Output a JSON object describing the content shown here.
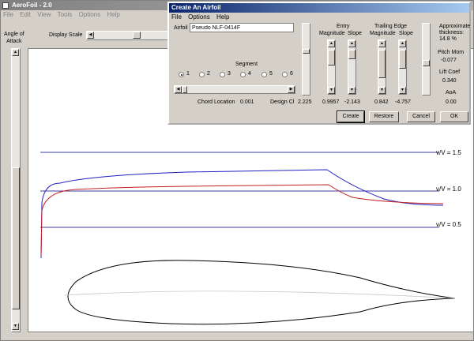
{
  "main": {
    "title": "AeroFoil - 2.0",
    "menu": [
      "File",
      "Edit",
      "View",
      "Tools",
      "Options",
      "Help"
    ],
    "angle_label_1": "Angle of",
    "angle_label_2": "Attack",
    "display_scale_label": "Display Scale"
  },
  "plot": {
    "velocity_labels": [
      "v/V = 1.5",
      "v/V = 1.0",
      "v/V = 0.5"
    ],
    "colors": {
      "upper": "#2020c0",
      "lower": "#c02020",
      "reference": "#000080",
      "profile": "#000000"
    }
  },
  "dialog": {
    "title": "Create An Airfoil",
    "menu": [
      "File",
      "Options",
      "Help"
    ],
    "airfoil_label": "Airfoil",
    "airfoil_name": "Pseudo NLF-0414F",
    "segment_label": "Segment",
    "segments": [
      "1",
      "2",
      "3",
      "4",
      "5",
      "6"
    ],
    "selected_segment": "1",
    "chord_location_label": "Chord Location",
    "chord_location_value": "0.001",
    "design_cl_label": "Design Cl",
    "design_cl_value": "2.225",
    "entry_label": "Entry",
    "trailing_edge_label": "Trailing Edge",
    "magnitude_label": "Magnitude",
    "slope_label": "Slope",
    "entry_magnitude": "0.9957",
    "entry_slope": "-2.143",
    "te_magnitude": "0.842",
    "te_slope": "-4.757",
    "thickness_label_1": "Approximate",
    "thickness_label_2": "thickness:",
    "thickness_value": "14.8 %",
    "pitch_mom_label": "Pitch Mom",
    "pitch_mom_value": "-0.077",
    "lift_coef_label": "Lift Coef",
    "lift_coef_value": "0.340",
    "aoa_label": "AoA",
    "aoa_value": "0.00",
    "buttons": {
      "create": "Create",
      "restore": "Restore",
      "cancel": "Cancel",
      "ok": "OK"
    }
  }
}
